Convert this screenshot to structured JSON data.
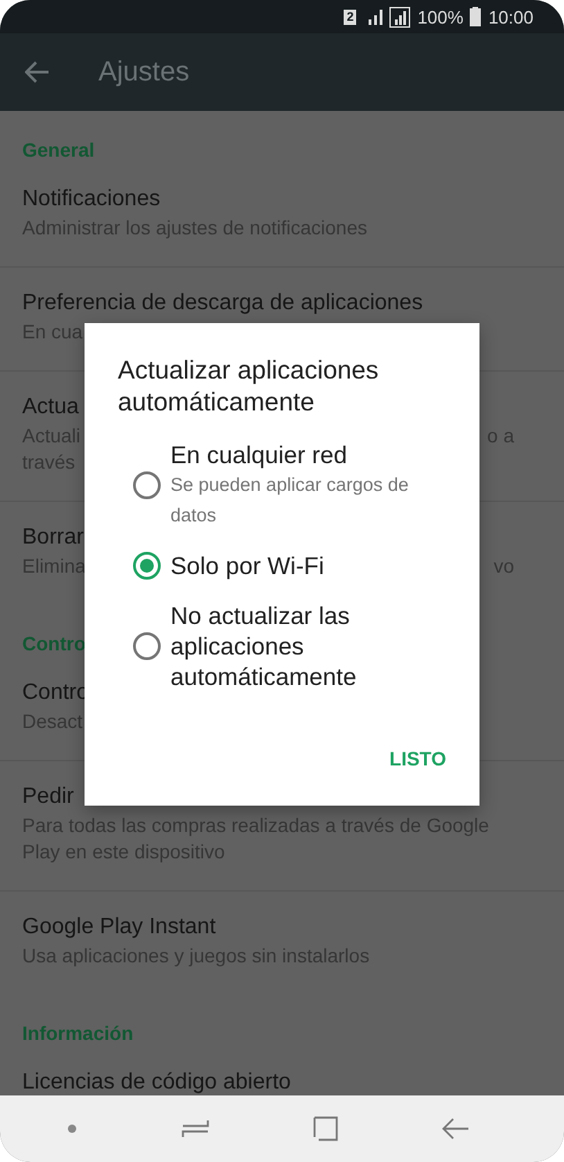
{
  "status_bar": {
    "sim_badge": "2",
    "battery": "100%",
    "time": "10:00"
  },
  "app_bar": {
    "title": "Ajustes"
  },
  "settings": [
    {
      "kind": "header",
      "title": "General"
    },
    {
      "kind": "row",
      "title": "Notificaciones",
      "subtitle": [
        "Administrar los ajustes de notificaciones"
      ]
    },
    {
      "kind": "row",
      "title": "Preferencia de descarga de aplicaciones",
      "subtitle": [
        "En cua"
      ]
    },
    {
      "kind": "row",
      "title": "Actua",
      "subtitle": [
        "Actuali",
        "través"
      ],
      "subtitle_right": "o a"
    },
    {
      "kind": "row",
      "title": "Borrar",
      "subtitle": [
        "Elimina"
      ],
      "subtitle_right": "vo"
    },
    {
      "kind": "header",
      "title": "Contro"
    },
    {
      "kind": "row",
      "title": "Contro",
      "subtitle": [
        "Desact"
      ]
    },
    {
      "kind": "row",
      "title": "Pedir",
      "subtitle": [
        "Para todas las compras realizadas a través de Google",
        "Play en este dispositivo"
      ]
    },
    {
      "kind": "row",
      "title": "Google Play Instant",
      "subtitle": [
        "Usa aplicaciones y juegos sin instalarlos"
      ]
    },
    {
      "kind": "header",
      "title": "Información"
    },
    {
      "kind": "row",
      "title": "Licencias de código abierto"
    }
  ],
  "dialog": {
    "title": "Actualizar aplicaciones automáticamente",
    "options": [
      {
        "label": "En cualquier red",
        "sublabel": "Se pueden aplicar cargos de datos",
        "selected": false
      },
      {
        "label": "Solo por Wi-Fi",
        "selected": true
      },
      {
        "label": "No actualizar las aplicaciones automáticamente",
        "selected": false
      }
    ],
    "button": "LISTO"
  }
}
